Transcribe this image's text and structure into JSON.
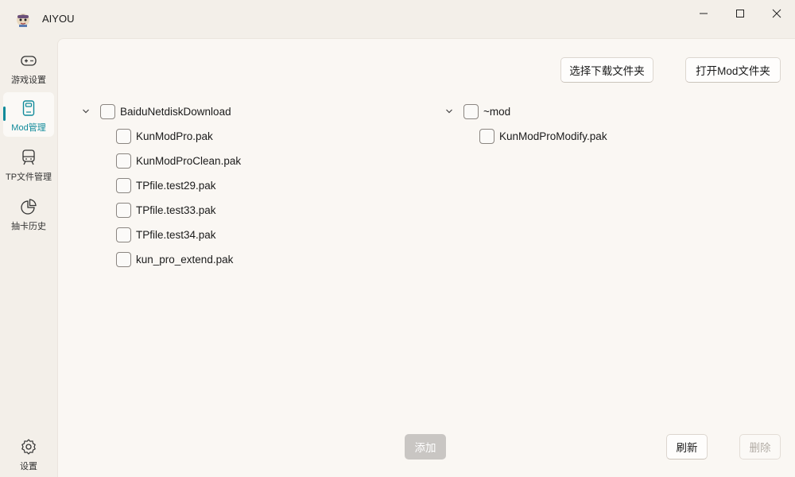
{
  "app": {
    "title": "AIYOU"
  },
  "nav": {
    "items": [
      {
        "label": "游戏设置",
        "icon": "gamepad-icon"
      },
      {
        "label": "Mod管理",
        "icon": "document-icon",
        "active": true
      },
      {
        "label": "TP文件管理",
        "icon": "train-icon"
      },
      {
        "label": "抽卡历史",
        "icon": "pie-chart-icon"
      }
    ],
    "settings": {
      "label": "设置",
      "icon": "gear-icon"
    }
  },
  "toolbar": {
    "select_folder_label": "选择下载文件夹",
    "open_mod_folder_label": "打开Mod文件夹"
  },
  "left_tree": {
    "root": {
      "label": "BaiduNetdiskDownload",
      "expanded": true,
      "checked": false
    },
    "children": [
      {
        "label": "KunModPro.pak",
        "checked": false
      },
      {
        "label": "KunModProClean.pak",
        "checked": false
      },
      {
        "label": "TPfile.test29.pak",
        "checked": false
      },
      {
        "label": "TPfile.test33.pak",
        "checked": false
      },
      {
        "label": "TPfile.test34.pak",
        "checked": false
      },
      {
        "label": "kun_pro_extend.pak",
        "checked": false
      }
    ]
  },
  "right_tree": {
    "root": {
      "label": "~mod",
      "expanded": true,
      "checked": false
    },
    "children": [
      {
        "label": "KunModProModify.pak",
        "checked": false
      }
    ]
  },
  "actions": {
    "add_label": "添加",
    "refresh_label": "刷新",
    "delete_label": "删除"
  },
  "colors": {
    "accent": "#0f8a9a",
    "sidebar_bg": "#f3efe9",
    "content_bg": "#faf7f3"
  }
}
